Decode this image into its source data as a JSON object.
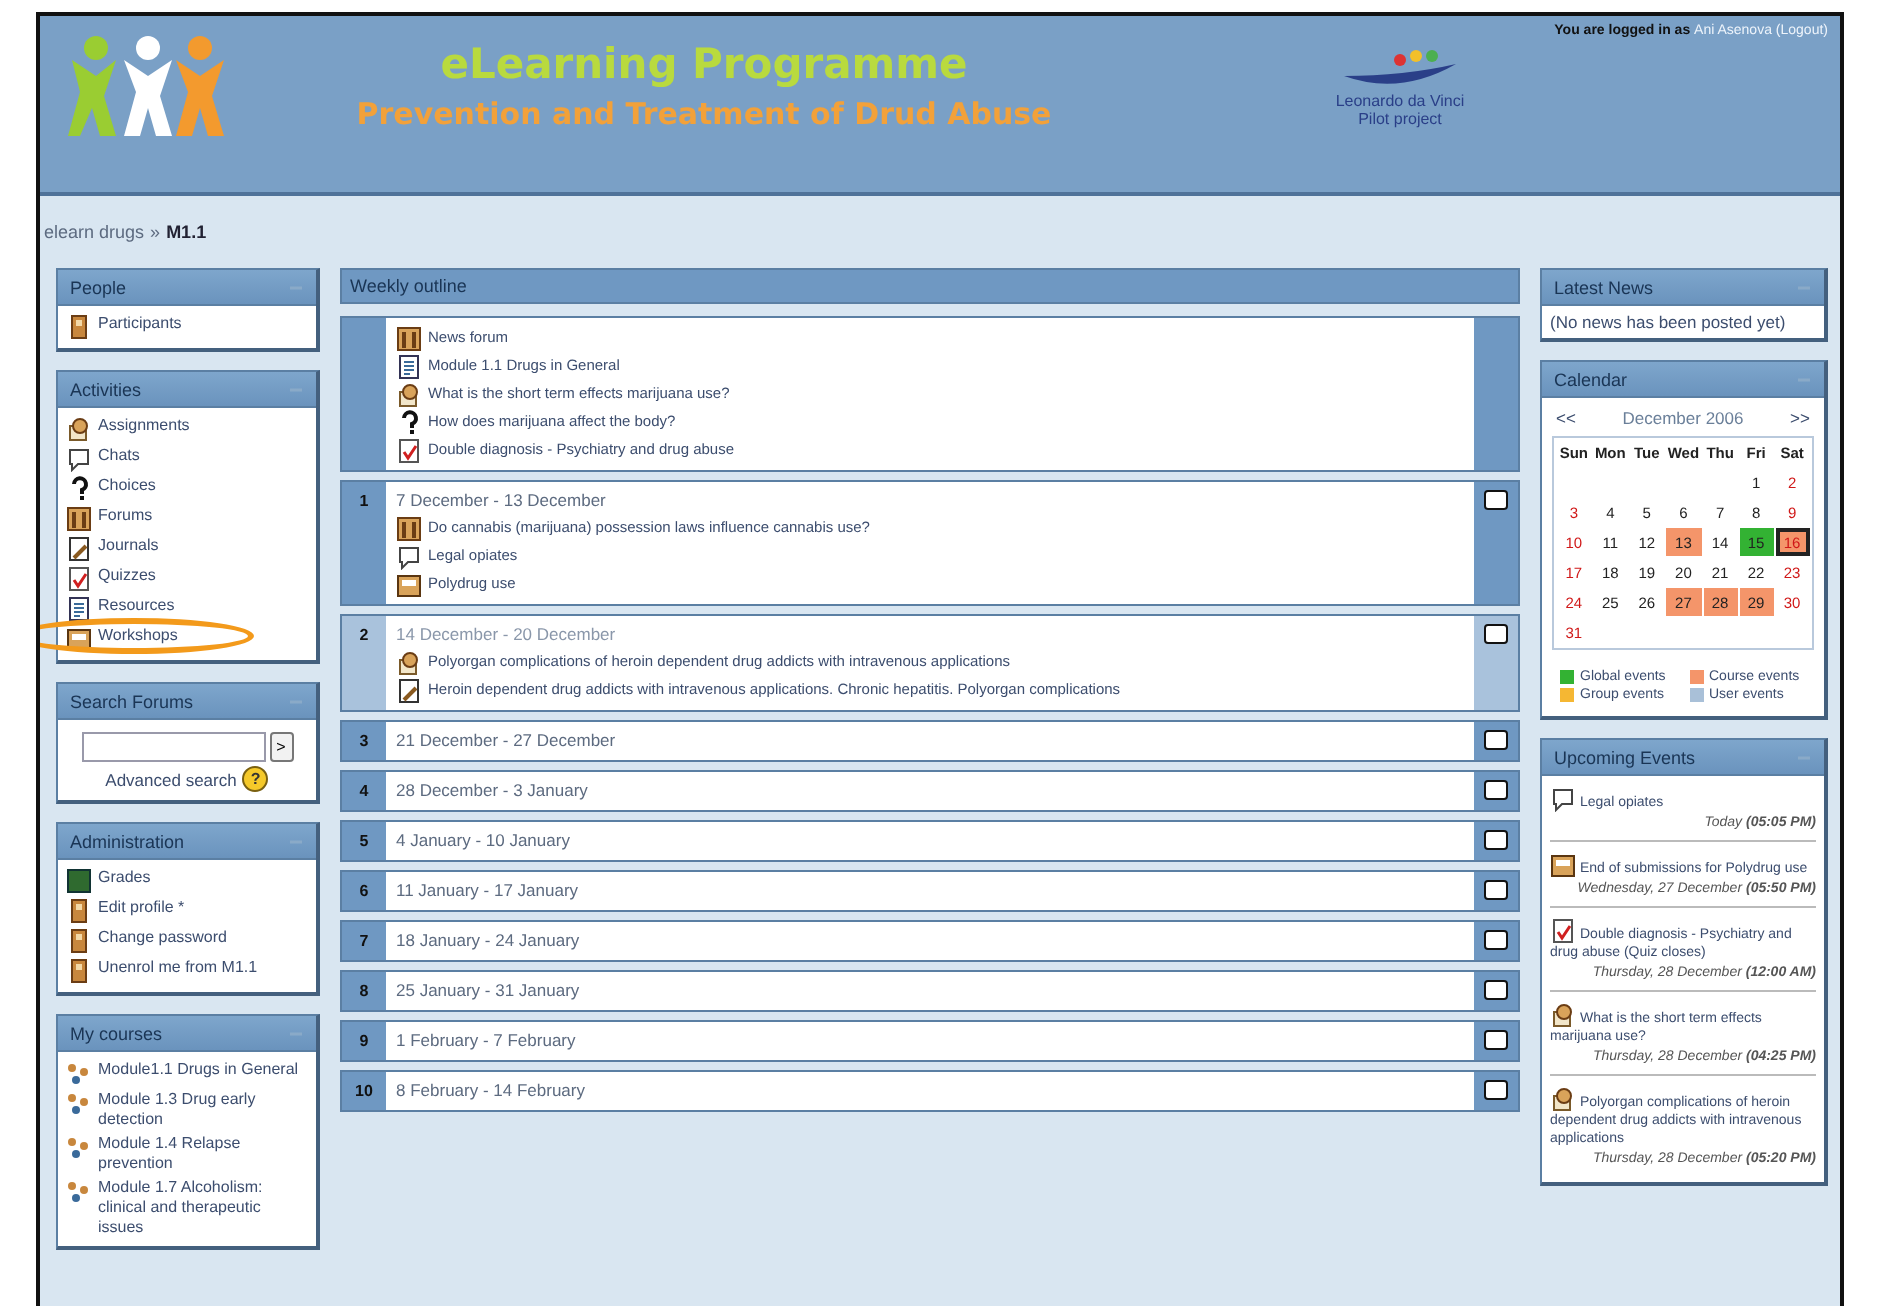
{
  "header": {
    "title": "eLearning Programme",
    "subtitle": "Prevention and Treatment of Drud Abuse",
    "partner_lines": [
      "Leonardo da Vinci",
      "Pilot project"
    ],
    "login": {
      "prefix": "You are logged in as",
      "user": "Ani Asenova",
      "logout": "(Logout)"
    }
  },
  "breadcrumb": {
    "items": [
      "elearn drugs",
      "M1.1"
    ],
    "separator": "»"
  },
  "left_blocks": [
    {
      "title": "People",
      "kind": "list",
      "items": [
        {
          "label": "Participants",
          "kind": "person"
        }
      ]
    },
    {
      "title": "Activities",
      "kind": "list",
      "items": [
        {
          "label": "Assignments",
          "kind": "assignment",
          "circled": false
        },
        {
          "label": "Chats",
          "kind": "chat",
          "circled": false
        },
        {
          "label": "Choices",
          "kind": "choice",
          "circled": false
        },
        {
          "label": "Forums",
          "kind": "forum",
          "circled": false
        },
        {
          "label": "Journals",
          "kind": "journal",
          "circled": false
        },
        {
          "label": "Quizzes",
          "kind": "quiz",
          "circled": false
        },
        {
          "label": "Resources",
          "kind": "resource",
          "circled": false
        },
        {
          "label": "Workshops",
          "kind": "workshop",
          "circled": true
        }
      ]
    },
    {
      "title": "Search Forums",
      "kind": "search",
      "button": ">",
      "link": "Advanced search",
      "help": "?"
    },
    {
      "title": "Administration",
      "kind": "list",
      "items": [
        {
          "label": "Grades",
          "kind": "grades"
        },
        {
          "label": "Edit profile *",
          "kind": "person"
        },
        {
          "label": "Change password",
          "kind": "person"
        },
        {
          "label": "Unenrol me from M1.1",
          "kind": "person"
        }
      ]
    },
    {
      "title": "My courses",
      "kind": "list",
      "items": [
        {
          "label": "Module1.1 Drugs in General",
          "kind": "course"
        },
        {
          "label": "Module 1.3 Drug early detection",
          "kind": "course"
        },
        {
          "label": "Module 1.4 Relapse prevention",
          "kind": "course"
        },
        {
          "label": "Module 1.7 Alcoholism: clinical and therapeutic issues",
          "kind": "course"
        }
      ]
    }
  ],
  "outline": {
    "title": "Weekly outline",
    "sections": [
      {
        "current": false,
        "items": [
          {
            "label": "News forum",
            "kind": "forum"
          },
          {
            "label": "Module 1.1 Drugs in General",
            "kind": "resource"
          },
          {
            "label": "What is the short term effects marijuana use?",
            "kind": "assignment"
          },
          {
            "label": "How does marijuana affect the body?",
            "kind": "choice"
          },
          {
            "label": "Double diagnosis - Psychiatry and drug abuse",
            "kind": "quiz"
          }
        ]
      },
      {
        "number": "1",
        "dates": "7 December - 13 December",
        "current": false,
        "items": [
          {
            "label": "Do cannabis (marijuana) possession laws influence cannabis use?",
            "kind": "forum"
          },
          {
            "label": "Legal opiates",
            "kind": "chat"
          },
          {
            "label": "Polydrug use",
            "kind": "workshop"
          }
        ]
      },
      {
        "number": "2",
        "dates": "14 December - 20 December",
        "current": true,
        "items": [
          {
            "label": "Polyorgan complications of heroin dependent drug addicts with intravenous applications",
            "kind": "assignment"
          },
          {
            "label": "Heroin dependent drug addicts with intravenous applications. Chronic hepatitis. Polyorgan complications",
            "kind": "journal"
          }
        ]
      },
      {
        "number": "3",
        "dates": "21 December - 27 December",
        "current": false
      },
      {
        "number": "4",
        "dates": "28 December - 3 January",
        "current": false
      },
      {
        "number": "5",
        "dates": "4 January - 10 January",
        "current": false
      },
      {
        "number": "6",
        "dates": "11 January - 17 January",
        "current": false
      },
      {
        "number": "7",
        "dates": "18 January - 24 January",
        "current": false
      },
      {
        "number": "8",
        "dates": "25 January - 31 January",
        "current": false
      },
      {
        "number": "9",
        "dates": "1 February - 7 February",
        "current": false
      },
      {
        "number": "10",
        "dates": "8 February - 14 February",
        "current": false
      }
    ]
  },
  "news": {
    "title": "Latest News",
    "text": "(No news has been posted yet)"
  },
  "calendar": {
    "title": "Calendar",
    "prev": "<<",
    "month": "December 2006",
    "next": ">>",
    "weekdays": [
      "Sun",
      "Mon",
      "Tue",
      "Wed",
      "Thu",
      "Fri",
      "Sat"
    ],
    "weeks": [
      [
        {
          "day": "1"
        },
        {
          "day": "2"
        }
      ],
      [
        {
          "day": "3"
        },
        {
          "day": "4"
        },
        {
          "day": "5"
        },
        {
          "day": "6"
        },
        {
          "day": "7"
        },
        {
          "day": "8"
        },
        {
          "day": "9"
        }
      ],
      [
        {
          "day": "10"
        },
        {
          "day": "11"
        },
        {
          "day": "12"
        },
        {
          "day": "13",
          "color": "#f4956a"
        },
        {
          "day": "14"
        },
        {
          "day": "15",
          "color": "#33b233"
        },
        {
          "day": "16",
          "color": "#f4956a",
          "today": true
        }
      ],
      [
        {
          "day": "17"
        },
        {
          "day": "18"
        },
        {
          "day": "19"
        },
        {
          "day": "20"
        },
        {
          "day": "21"
        },
        {
          "day": "22"
        },
        {
          "day": "23"
        }
      ],
      [
        {
          "day": "24"
        },
        {
          "day": "25"
        },
        {
          "day": "26"
        },
        {
          "day": "27",
          "color": "#f4956a"
        },
        {
          "day": "28",
          "color": "#f4956a"
        },
        {
          "day": "29",
          "color": "#f4956a"
        },
        {
          "day": "30"
        }
      ],
      [
        {
          "day": "31"
        }
      ]
    ],
    "legend": [
      {
        "label": "Global events",
        "color": "#33b233"
      },
      {
        "label": "Course events",
        "color": "#f4956a"
      },
      {
        "label": "Group events",
        "color": "#f5b733"
      },
      {
        "label": "User events",
        "color": "#a9c0d8"
      }
    ]
  },
  "upcoming": {
    "title": "Upcoming Events",
    "events": [
      {
        "kind": "chat",
        "title": "Legal opiates",
        "date": "Today",
        "time": "(05:05 PM)"
      },
      {
        "kind": "workshop",
        "title": "End of submissions for Polydrug use",
        "date": "Wednesday, 27 December",
        "time": "(05:50 PM)"
      },
      {
        "kind": "quiz",
        "title": "Double diagnosis - Psychiatry and drug abuse (Quiz closes)",
        "date": "Thursday, 28 December",
        "time": "(12:00 AM)"
      },
      {
        "kind": "assignment",
        "title": "What is the short term effects marijuana use?",
        "date": "Thursday, 28 December",
        "time": "(04:25 PM)"
      },
      {
        "kind": "assignment",
        "title": "Polyorgan complications of heroin dependent drug addicts with intravenous applications",
        "date": "Thursday, 28 December",
        "time": "(05:20 PM)"
      }
    ]
  }
}
